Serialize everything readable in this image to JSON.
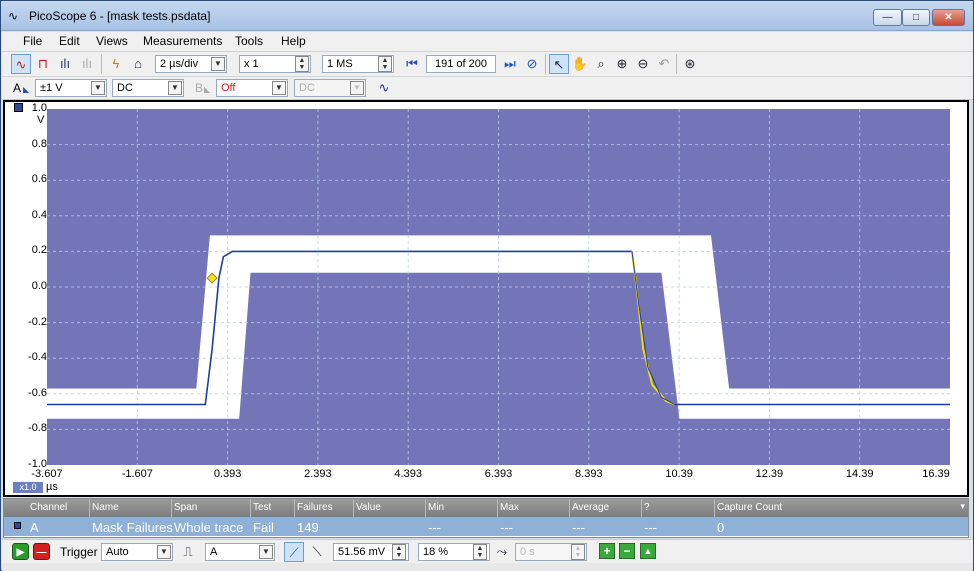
{
  "window": {
    "title": "PicoScope 6 - [mask tests.psdata]",
    "min_glyph": "—",
    "max_glyph": "□",
    "close_glyph": "✕",
    "app_icon": "oscilloscope-icon"
  },
  "menu": [
    {
      "label": "File"
    },
    {
      "label": "Edit"
    },
    {
      "label": "Views"
    },
    {
      "label": "Measurements"
    },
    {
      "label": "Tools"
    },
    {
      "label": "Help"
    }
  ],
  "toolbar": {
    "timebase": "2 µs/div",
    "zoom": "x 1",
    "samples": "1 MS",
    "buffer_position": "191",
    "buffer_total": "of 200",
    "icons": [
      "scope-mode-icon",
      "persistence-mode-icon",
      "spectrum-mode-icon",
      "disabled-mode-icon",
      "probe-icon",
      "home-icon",
      "first-icon",
      "next-icon",
      "compass-icon",
      "pointer-icon",
      "hand-icon",
      "zoom-icon",
      "zoom-in-icon",
      "zoom-out-icon",
      "undo-zoom-icon",
      "zoom-overview-icon"
    ]
  },
  "channels": {
    "a_label": "A",
    "a_range": "±1 V",
    "a_coupling": "DC",
    "b_label": "B",
    "b_range": "Off",
    "b_coupling": "DC",
    "autoset_icon": "autoset-icon"
  },
  "scope": {
    "y_unit": "V",
    "x_unit": "µs",
    "x_multiplier": "x1.0",
    "y_ticks": [
      "1.0",
      "0.8",
      "0.6",
      "0.4",
      "0.2",
      "0.0",
      "-0.2",
      "-0.4",
      "-0.6",
      "-0.8",
      "-1.0"
    ],
    "x_ticks": [
      "-3.607",
      "-1.607",
      "0.393",
      "2.393",
      "4.393",
      "6.393",
      "8.393",
      "10.39",
      "12.39",
      "14.39",
      "16.39"
    ],
    "background_color": "#7375b8",
    "mask_color": "#ffffff",
    "trace_color": "#1e3da8",
    "failure_color": "#f0e000",
    "trace": {
      "low_v": -0.66,
      "high_v": 0.2,
      "rise_us": 0.2,
      "fall_us": 9.35
    },
    "mask_outer": {
      "low_v": -0.57,
      "high_v": 0.29,
      "rise_start_us": -0.3,
      "rise_end_us": 0.0,
      "fall_start_us": 11.1,
      "fall_end_us": 11.5
    },
    "mask_inner": {
      "low_v": -0.74,
      "high_v": 0.08,
      "rise_start_us": 0.65,
      "rise_end_us": 0.9,
      "fall_start_us": 10.0,
      "fall_end_us": 10.4
    }
  },
  "measurements": {
    "headers": [
      "Channel",
      "Name",
      "Span",
      "Test",
      "Failures",
      "Value",
      "Min",
      "Max",
      "Average",
      "?",
      "Capture Count"
    ],
    "row": [
      "A",
      "Mask Failures",
      "Whole trace",
      "Fail",
      "149",
      "",
      "---",
      "---",
      "---",
      "---",
      "0"
    ]
  },
  "trigger": {
    "label": "Trigger",
    "mode": "Auto",
    "source": "A",
    "threshold": "51.56 mV",
    "pre_trigger": "18 %",
    "delay": "0 s"
  }
}
